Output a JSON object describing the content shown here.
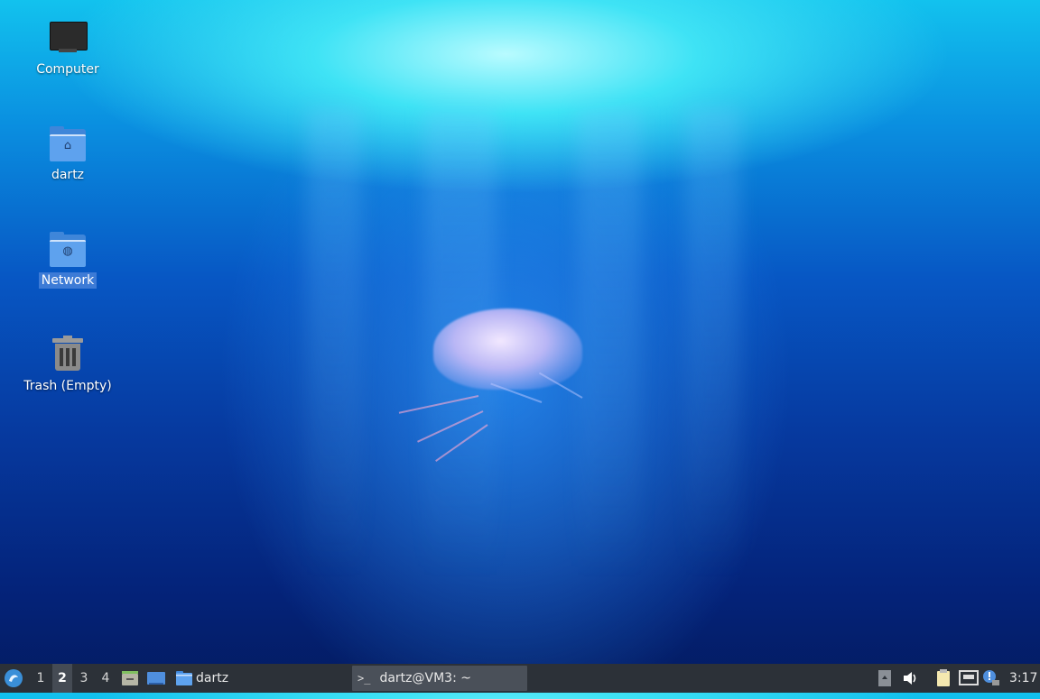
{
  "desktop": {
    "icons": [
      {
        "label": "Computer",
        "icon": "monitor-icon"
      },
      {
        "label": "dartz",
        "icon": "home-folder-icon"
      },
      {
        "label": "Network",
        "icon": "network-folder-icon",
        "selected": true
      },
      {
        "label": "Trash (Empty)",
        "icon": "trash-icon"
      }
    ]
  },
  "taskbar": {
    "menu_icon": "whisker-menu-icon",
    "workspaces": [
      "1",
      "2",
      "3",
      "4"
    ],
    "active_workspace": "2",
    "launchers": [
      {
        "icon": "file-manager-icon"
      },
      {
        "icon": "show-desktop-icon"
      }
    ],
    "folder_launcher": {
      "icon": "folder-icon",
      "label": "dartz"
    },
    "task": {
      "icon": "terminal-icon",
      "label": "dartz@VM3: ~"
    },
    "tray": [
      {
        "icon": "notification-area-icon"
      },
      {
        "icon": "volume-icon"
      },
      {
        "icon": "clipboard-icon"
      },
      {
        "icon": "network-icon"
      },
      {
        "icon": "updates-icon"
      }
    ],
    "clock": "3:17"
  }
}
